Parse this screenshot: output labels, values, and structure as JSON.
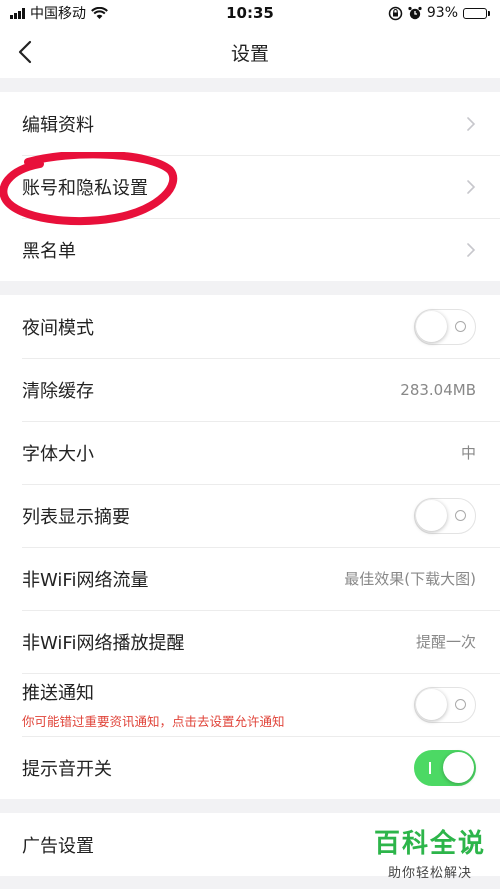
{
  "status_bar": {
    "carrier": "中国移动",
    "time": "10:35",
    "battery": "93%",
    "battery_level": 0.93
  },
  "nav": {
    "title": "设置"
  },
  "groups": [
    {
      "rows": [
        {
          "label": "编辑资料",
          "control": "chevron"
        },
        {
          "label": "账号和隐私设置",
          "control": "chevron"
        },
        {
          "label": "黑名单",
          "control": "chevron"
        }
      ]
    },
    {
      "rows": [
        {
          "label": "夜间模式",
          "control": "switch",
          "on": false
        },
        {
          "label": "清除缓存",
          "control": "value",
          "value": "283.04MB"
        },
        {
          "label": "字体大小",
          "control": "value",
          "value": "中"
        },
        {
          "label": "列表显示摘要",
          "control": "switch",
          "on": false
        },
        {
          "label": "非WiFi网络流量",
          "control": "value",
          "value": "最佳效果(下载大图)"
        },
        {
          "label": "非WiFi网络播放提醒",
          "control": "value",
          "value": "提醒一次"
        },
        {
          "label": "推送通知",
          "sublabel": "你可能错过重要资讯通知，点击去设置允许通知",
          "control": "switch",
          "on": false
        },
        {
          "label": "提示音开关",
          "control": "switch",
          "on": true
        }
      ]
    },
    {
      "rows": [
        {
          "label": "广告设置",
          "control": "chevron"
        }
      ]
    }
  ],
  "watermark": {
    "main": "百科全说",
    "sub": "助你轻松解决"
  },
  "colors": {
    "switch_on": "#4cd964",
    "warning_text": "#e0443a",
    "annotation": "#e8103a",
    "watermark": "#2db54a"
  }
}
